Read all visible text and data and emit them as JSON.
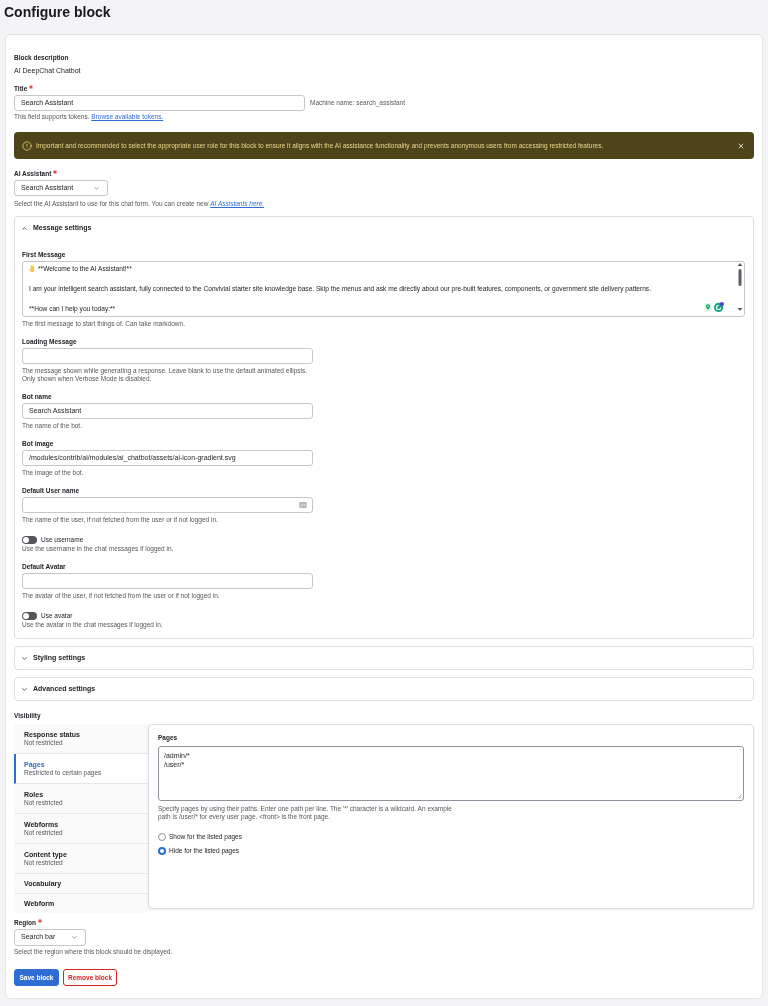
{
  "page": {
    "title": "Configure block"
  },
  "block_description": {
    "label": "Block description",
    "value": "AI DeepChat Chatbot"
  },
  "title_field": {
    "label": "Title",
    "required": true,
    "value": "Search Assistant",
    "machine_name": "Machine name: search_assistant",
    "help": "This field supports tokens.",
    "help_link": "Browse available tokens."
  },
  "warning": {
    "message": "Important and recommended to select the appropriate user role for this block to ensure it aligns with the AI assistance functionality and prevents anonymous users from accessing restricted features."
  },
  "ai_assistant": {
    "label": "AI Assistant",
    "required": true,
    "value": "Search Assistant",
    "help": "Select the AI Assistant to use for this chat form. You can create new",
    "help_link": "AI Assistants here."
  },
  "sections": [
    {
      "title": "Message settings",
      "expanded": true,
      "fields": [
        {
          "kind": "textarea",
          "label": "First Message",
          "value": "**Welcome to the AI Assistant!**\n\nI am your intelligent search assistant, fully connected to the Convivial starter site knowledge base. Skip the menus and ask me directly about our pre-built features, components, or government site delivery patterns.\n\n**How can I help you today:**",
          "help": [
            "The first message to start things of. Can take markdown."
          ]
        },
        {
          "kind": "text",
          "label": "Loading Message",
          "help": [
            "The message shown while generating a response. Leave blank to use the default animated ellipsis.",
            "Only shown when Verbose Mode is disabled."
          ]
        },
        {
          "kind": "text",
          "label": "Bot name",
          "value": "Search Assistant",
          "help": [
            "The name of the bot."
          ]
        },
        {
          "kind": "text",
          "label": "Bot image",
          "value": "/modules/contrib/ai/modules/ai_chatbot/assets/ai-icon-gradient.svg",
          "help": [
            "The image of the bot."
          ]
        },
        {
          "kind": "text",
          "label": "Default User name",
          "autofill_icon": true,
          "help": [
            "The name of the user, if not fetched from the user or if not logged in."
          ]
        },
        {
          "kind": "toggle",
          "label": "Use username",
          "on": false,
          "help": [
            "Use the username in the chat messages if logged in."
          ]
        },
        {
          "kind": "text",
          "label": "Default Avatar",
          "help": [
            "The avatar of the user, if not fetched from the user or if not logged in."
          ]
        },
        {
          "kind": "toggle",
          "label": "Use avatar",
          "on": false,
          "help": [
            "Use the avatar in the chat messages if logged in."
          ]
        }
      ]
    },
    {
      "title": "Styling settings",
      "expanded": false
    },
    {
      "title": "Advanced settings",
      "expanded": false
    }
  ],
  "visibility": {
    "label": "Visibility",
    "tabs": [
      {
        "title": "Response status",
        "summary": "Not restricted",
        "selected": false
      },
      {
        "title": "Pages",
        "summary": "Restricted to certain pages",
        "selected": true
      },
      {
        "title": "Roles",
        "summary": "Not restricted",
        "selected": false
      },
      {
        "title": "Webforms",
        "summary": "Not restricted",
        "selected": false
      },
      {
        "title": "Content type",
        "summary": "Not restricted",
        "selected": false
      },
      {
        "title": "Vocabulary",
        "selected": false
      },
      {
        "title": "Webform",
        "selected": false
      }
    ],
    "pages": {
      "label": "Pages",
      "value": "/admin/*\n/user/*",
      "help": "Specify pages by using their paths. Enter one path per line. The '*' character is a wildcard. An example path is /user/* for every user page. <front> is the front page.",
      "options": [
        {
          "label": "Show for the listed pages",
          "selected": false
        },
        {
          "label": "Hide for the listed pages",
          "selected": true
        }
      ]
    }
  },
  "region": {
    "label": "Region",
    "required": true,
    "value": "Search bar",
    "help": "Select the region where this block should be displayed."
  },
  "actions": [
    {
      "kind": "primary",
      "label": "Save block"
    },
    {
      "kind": "danger",
      "label": "Remove block"
    }
  ]
}
